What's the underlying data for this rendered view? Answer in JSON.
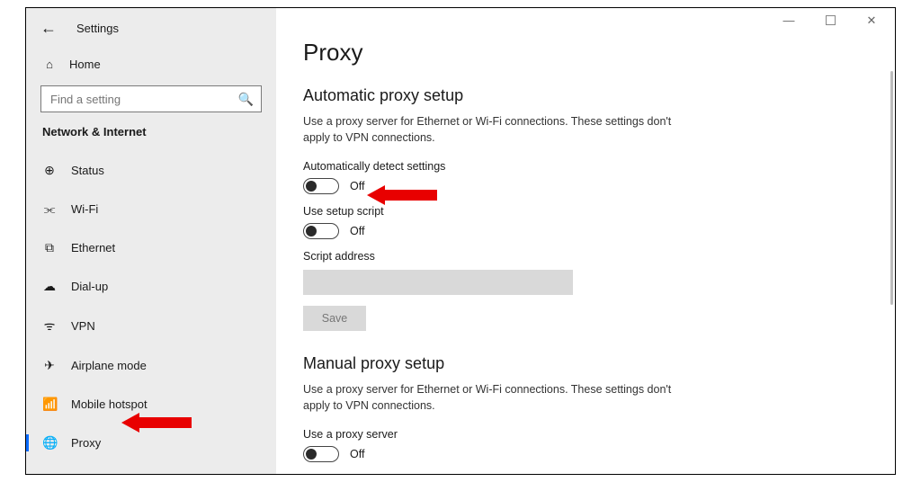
{
  "window": {
    "app_title": "Settings",
    "minimize_glyph": "—",
    "close_glyph": "✕"
  },
  "sidebar": {
    "back_glyph": "←",
    "home_label": "Home",
    "home_icon_glyph": "⌂",
    "search_placeholder": "Find a setting",
    "search_icon_glyph": "🔍",
    "section_label": "Network & Internet",
    "items": [
      {
        "label": "Status",
        "icon": "⊕"
      },
      {
        "label": "Wi-Fi",
        "icon": "⫘"
      },
      {
        "label": "Ethernet",
        "icon": "⧉"
      },
      {
        "label": "Dial-up",
        "icon": "☁"
      },
      {
        "label": "VPN",
        "icon": "ᯤ"
      },
      {
        "label": "Airplane mode",
        "icon": "✈"
      },
      {
        "label": "Mobile hotspot",
        "icon": "📶"
      },
      {
        "label": "Proxy",
        "icon": "🌐"
      }
    ]
  },
  "main": {
    "page_title": "Proxy",
    "auto_section": {
      "heading": "Automatic proxy setup",
      "description": "Use a proxy server for Ethernet or Wi-Fi connections. These settings don't apply to VPN connections.",
      "detect_label": "Automatically detect settings",
      "detect_state": "Off",
      "script_label": "Use setup script",
      "script_state": "Off",
      "address_label": "Script address",
      "address_value": "",
      "save_label": "Save"
    },
    "manual_section": {
      "heading": "Manual proxy setup",
      "description": "Use a proxy server for Ethernet or Wi-Fi connections. These settings don't apply to VPN connections.",
      "use_label": "Use a proxy server",
      "use_state": "Off"
    }
  },
  "annotations": {
    "arrow_targets": [
      "auto-detect-toggle",
      "sidebar-item-proxy"
    ]
  }
}
